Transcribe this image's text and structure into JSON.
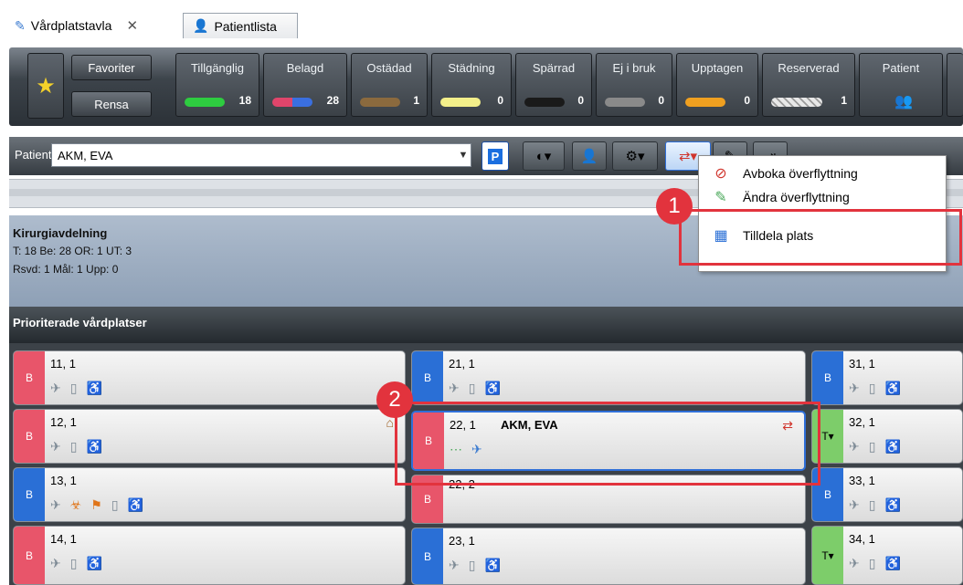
{
  "tabs": [
    {
      "label": "Vårdplatstavla",
      "close": "✕"
    },
    {
      "label": "Patientlista"
    }
  ],
  "ribbon": {
    "favorites_label": "Favoriter",
    "clear_label": "Rensa",
    "categories": [
      {
        "label": "Tillgänglig",
        "count": "18",
        "color": "#2ecc40"
      },
      {
        "label": "Belagd",
        "count": "28",
        "color": "#e0456b"
      },
      {
        "label": "Ostädad",
        "count": "1",
        "color": "#8b6a3e"
      },
      {
        "label": "Städning",
        "count": "0",
        "color": "#f3ef8a"
      },
      {
        "label": "Spärrad",
        "count": "0",
        "color": "#1a1a1a"
      },
      {
        "label": "Ej i bruk",
        "count": "0",
        "color": "#8a8a8a"
      },
      {
        "label": "Upptagen",
        "count": "0",
        "color": "#f0a020"
      },
      {
        "label": "Reserverad",
        "count": "1",
        "color": "#e8e8e8"
      },
      {
        "label": "Patient",
        "count": "",
        "color": ""
      }
    ]
  },
  "patient_bar": {
    "label": "Patient",
    "value": "AKM, EVA",
    "p_button": "P"
  },
  "department": {
    "name": "Kirurgiavdelning",
    "line1": "T: 18 Be: 28 OR: 1 UT: 3",
    "line2": "Rsvd: 1 Mål: 1 Upp: 0"
  },
  "priority_header": "Prioriterade vårdplatser",
  "beds": {
    "col1": [
      {
        "tag": "B",
        "num": "11, 1"
      },
      {
        "tag": "B",
        "num": "12, 1"
      },
      {
        "tag": "B",
        "num": "13, 1"
      },
      {
        "tag": "B",
        "num": "14, 1"
      }
    ],
    "col2": [
      {
        "tag": "B",
        "num": "21, 1"
      },
      {
        "tag": "B",
        "num": "22, 1",
        "patient": "AKM, EVA"
      },
      {
        "tag": "B",
        "num": "22, 2"
      },
      {
        "tag": "B",
        "num": "23, 1"
      }
    ],
    "col3": [
      {
        "tag": "B",
        "num": "31, 1"
      },
      {
        "tag": "T▾",
        "num": "32, 1"
      },
      {
        "tag": "B",
        "num": "33, 1"
      },
      {
        "tag": "T▾",
        "num": "34, 1"
      }
    ]
  },
  "context_menu": {
    "items": [
      {
        "label": "Avboka överflyttning",
        "icon": "cancel-icon"
      },
      {
        "label": "Ändra överflyttning",
        "icon": "edit-icon"
      },
      {
        "label": "Tilldela plats",
        "icon": "building-icon"
      }
    ]
  },
  "callouts": {
    "one": "1",
    "two": "2"
  }
}
